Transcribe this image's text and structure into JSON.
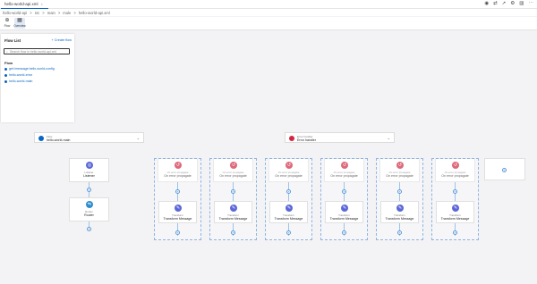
{
  "tab": {
    "title": "hello-world-api.xml",
    "close": "×"
  },
  "breadcrumb": [
    "hello-world-api",
    ">",
    "src",
    ">",
    "main",
    ">",
    "mule",
    ">",
    "hello-world-api.xml"
  ],
  "toolbar": {
    "flow_label": "Flow",
    "overview_label": "Overview"
  },
  "panel": {
    "heading": "Flow List",
    "create": "+ Create flow",
    "search_placeholder": "Search flow in hello-world-api.xml",
    "section": "Flow",
    "items": [
      "get:\\message:hello-world-config",
      "hello-world-error",
      "hello-world-main"
    ]
  },
  "flow_header": {
    "kind": "Flow",
    "name": "hello-world-main"
  },
  "error_header": {
    "kind": "Error handler",
    "name": "Error handler"
  },
  "main_steps": [
    {
      "kind": "Listener",
      "name": "Listener"
    },
    {
      "kind": "Router",
      "name": "Router"
    }
  ],
  "error_blocks": [
    {
      "kind": "On error propagate",
      "name": "On error propagate",
      "inner_kind": "Transform",
      "inner_name": "Transform Message"
    },
    {
      "kind": "On error propagate",
      "name": "On error propagate",
      "inner_kind": "Transform",
      "inner_name": "Transform Message"
    },
    {
      "kind": "On error propagate",
      "name": "On error propagate",
      "inner_kind": "Transform",
      "inner_name": "Transform Message"
    },
    {
      "kind": "On error propagate",
      "name": "On error propagate",
      "inner_kind": "Transform",
      "inner_name": "Transform Message"
    },
    {
      "kind": "On error propagate",
      "name": "On error propagate",
      "inner_kind": "Transform",
      "inner_name": "Transform Message"
    },
    {
      "kind": "On error propagate",
      "name": "On error propagate",
      "inner_kind": "Transform",
      "inner_name": "Transform Message"
    }
  ],
  "colors": {
    "accent": "#0b65c2",
    "error": "#d02841",
    "component": "#5b67d8"
  }
}
